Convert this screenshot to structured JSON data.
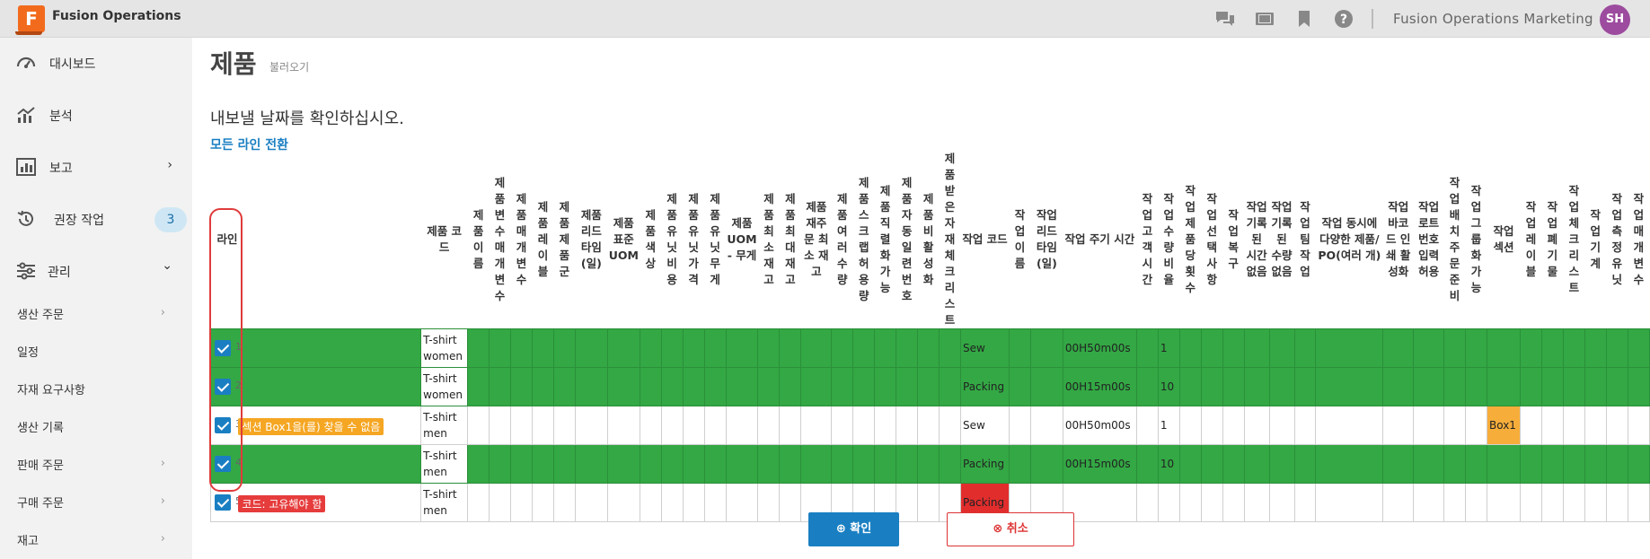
{
  "header": {
    "app_title": "Fusion Operations",
    "logo_letter": "F",
    "org": "Fusion Operations Marketing",
    "avatar": "SH",
    "icons": [
      "chat-icon",
      "video-icon",
      "bookmark-icon",
      "help-icon"
    ]
  },
  "sidebar": {
    "nav": [
      {
        "label": "대시보드",
        "icon": "dashboard-icon"
      },
      {
        "label": "분석",
        "icon": "analytics-icon"
      },
      {
        "label": "보고",
        "icon": "report-icon",
        "arrow": "›"
      },
      {
        "label": "권장 작업",
        "icon": "history-icon",
        "badge": "3"
      },
      {
        "label": "관리",
        "icon": "sliders-icon",
        "arrow": "⌄"
      }
    ],
    "sub": [
      {
        "label": "생산 주문",
        "arrow": "›"
      },
      {
        "label": "일정"
      },
      {
        "label": "자재 요구사항"
      },
      {
        "label": "생산 기록"
      },
      {
        "label": "판매 주문",
        "arrow": "›"
      },
      {
        "label": "구매 주문",
        "arrow": "›"
      },
      {
        "label": "재고",
        "arrow": "›"
      }
    ]
  },
  "page": {
    "title": "제품",
    "subtitle": "불러오기",
    "confirm": "내보낼 날짜를 확인하십시오.",
    "toggle_all": "모든 라인 전환"
  },
  "table": {
    "headers": [
      "라인",
      "",
      "제품 코드",
      "제품 이름",
      "제품 변수 매개변수",
      "제품 매개변수",
      "제품 레이블",
      "제품 제품군",
      "제품 리드 타임(일)",
      "제품 표준 UOM",
      "제품 색상",
      "제품 유닛 비용",
      "제품 유닛 가격",
      "제품 유닛 무게",
      "제품 UOM - 무게",
      "제품 최소 재고",
      "제품 최대 재고",
      "제품 재주문 최소 재고",
      "제품 여러 수량",
      "제품 스크랩 허용량",
      "제품 직렬화 가능",
      "제품 자동 일련 번호",
      "제품 비활성화",
      "제품 받은 자재 체크리스트",
      "작업 코드",
      "작업 이름",
      "작업 리드 타임(일)",
      "작업 주기 시간",
      "작업 고객 시간",
      "작업 수량 비율",
      "작업 제품당 횟수",
      "작업 선택 사항",
      "작업 복구",
      "작업 기록된 시간 없음",
      "작업 기록된 수량 없음",
      "작업 팀 작업",
      "작업 동시에 다양한 제품/PO(여러 개)",
      "작업 바코드 인쇄 활성화",
      "작업 로트 번호 입력 허용",
      "작업 배치 주문 준비",
      "작업 그룹화 가능",
      "작업 섹션",
      "작업 레이블",
      "작업 폐기물",
      "작업 체크리스트",
      "작업 기계",
      "작업 측정 유닛",
      "작업 매개변수"
    ],
    "rows": [
      {
        "num": "1",
        "checked": true,
        "error": "",
        "code": "T-shirt women",
        "op_code": "Sew",
        "cycle": "00H50m00s",
        "qty_ratio": "1",
        "section": ""
      },
      {
        "num": "2",
        "checked": true,
        "error": "",
        "code": "T-shirt women",
        "op_code": "Packing",
        "cycle": "00H15m00s",
        "qty_ratio": "10",
        "section": ""
      },
      {
        "num": "3",
        "checked": true,
        "error": "섹션 Box1을(를) 찾을 수 없음",
        "code": "T-shirt men",
        "op_code": "Sew",
        "cycle": "00H50m00s",
        "qty_ratio": "1",
        "section": "Box1"
      },
      {
        "num": "4",
        "checked": true,
        "error": "",
        "code": "T-shirt men",
        "op_code": "Packing",
        "cycle": "00H15m00s",
        "qty_ratio": "10",
        "section": ""
      },
      {
        "num": "5",
        "checked": true,
        "error": "코드: 고유해야 함",
        "code": "T-shirt men",
        "op_code": "Packing",
        "cycle": "",
        "qty_ratio": "",
        "section": ""
      }
    ]
  },
  "buttons": {
    "ok": "⊕ 확인",
    "cancel": "⊗ 취소"
  }
}
